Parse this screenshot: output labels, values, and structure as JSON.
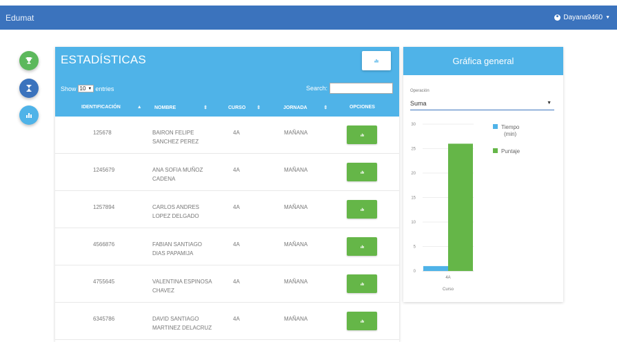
{
  "navbar": {
    "brand": "Edumat",
    "user": "Dayana9460"
  },
  "side_buttons": [
    {
      "name": "trophy-icon",
      "color": "#5cb85c"
    },
    {
      "name": "hourglass-icon",
      "color": "#3b73bd"
    },
    {
      "name": "bar-chart-icon",
      "color": "#4fb3e8"
    }
  ],
  "panel": {
    "title": "ESTADÍSTICAS",
    "show_label": "Show",
    "entries_value": "10",
    "entries_label": "entries",
    "search_label": "Search:",
    "search_value": "",
    "columns": [
      "IDENTIFICACIÓN",
      "NOMBRE",
      "CURSO",
      "JORNADA",
      "OPCIONES"
    ],
    "rows": [
      {
        "id": "125678",
        "name_1": "BAIRON FELIPE",
        "name_2": "SANCHEZ PEREZ",
        "curso": "4A",
        "jornada": "MAÑANA"
      },
      {
        "id": "1245679",
        "name_1": "ANA SOFIA MUÑOZ",
        "name_2": "CADENA",
        "curso": "4A",
        "jornada": "MAÑANA"
      },
      {
        "id": "1257894",
        "name_1": "CARLOS ANDRES",
        "name_2": "LOPEZ DELGADO",
        "curso": "4A",
        "jornada": "MAÑANA"
      },
      {
        "id": "4566876",
        "name_1": "FABIAN SANTIAGO",
        "name_2": "DIAS PAPAMIJA",
        "curso": "4A",
        "jornada": "MAÑANA"
      },
      {
        "id": "4755645",
        "name_1": "VALENTINA ESPINOSA",
        "name_2": "CHAVEZ",
        "curso": "4A",
        "jornada": "MAÑANA"
      },
      {
        "id": "6345786",
        "name_1": "DAVID SANTIAGO",
        "name_2": "MARTINEZ DELACRUZ",
        "curso": "4A",
        "jornada": "MAÑANA"
      }
    ]
  },
  "chart_card": {
    "title": "Gráfica general",
    "operation_label": "Operación",
    "operation_value": "Suma"
  },
  "chart_data": {
    "type": "bar",
    "categories": [
      "4A"
    ],
    "series": [
      {
        "name": "Tiempo (min)",
        "values": [
          1
        ],
        "color": "#4fb3e8"
      },
      {
        "name": "Puntaje",
        "values": [
          26
        ],
        "color": "#65b648"
      }
    ],
    "xlabel": "Curso",
    "ylabel": "",
    "ylim": [
      0,
      30
    ],
    "yticks": [
      0,
      5,
      10,
      15,
      20,
      25,
      30
    ],
    "legend_position": "right",
    "grid": true
  }
}
